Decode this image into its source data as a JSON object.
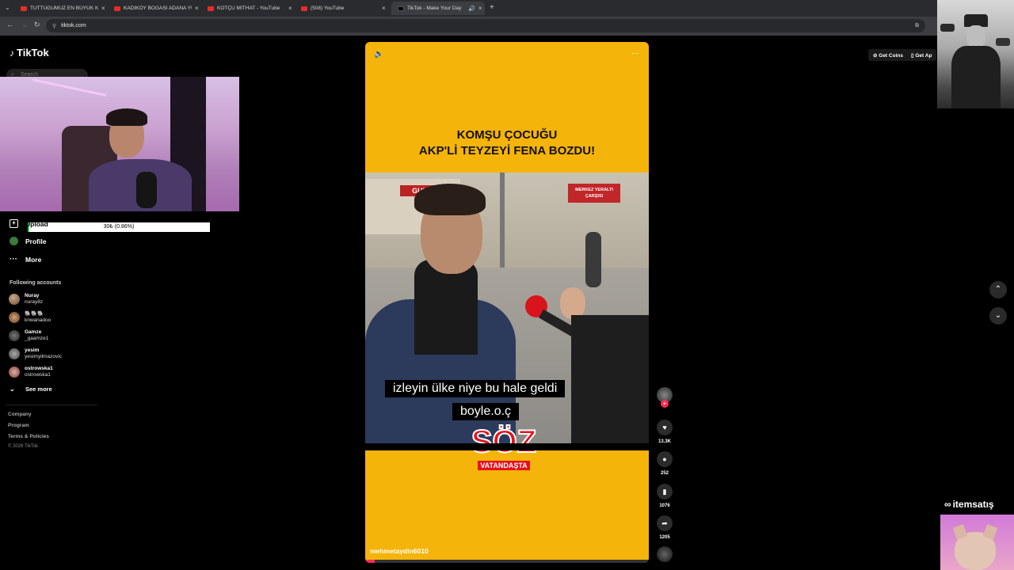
{
  "browser": {
    "tabs": [
      {
        "label": "TUTTUĞUMUZ EN BÜYÜK KILIÇ",
        "type": "youtube"
      },
      {
        "label": "KADIKÖY BOĞASI ADANA YÜRÜ",
        "type": "youtube"
      },
      {
        "label": "KOTÇU MİTHAT - YouTube",
        "type": "youtube"
      },
      {
        "label": "(508) YouTube",
        "type": "youtube"
      },
      {
        "label": "TikTok - Make Your Day",
        "type": "tiktok"
      }
    ],
    "new_tab": "+",
    "url": "tiktok.com"
  },
  "tiktok": {
    "logo": "TikTok",
    "search_placeholder": "Search",
    "nav": {
      "upload": "Upload",
      "profile": "Profile",
      "more": "More"
    },
    "following_title": "Following accounts",
    "accounts": [
      {
        "name": "Nuray",
        "user": "nuray8z"
      },
      {
        "name": "🐘🐘🐘",
        "user": "knwanadoo"
      },
      {
        "name": "Gamze",
        "user": "_gaamze1"
      },
      {
        "name": "yesim",
        "user": "yesimyilmazovic"
      },
      {
        "name": "ostrowska1",
        "user": "ostrowska1"
      }
    ],
    "see_more": "See more",
    "footer": [
      "Company",
      "Program",
      "Terms & Policies",
      "© 2026 TikTok"
    ],
    "top_right": {
      "get_coins": "Get Coins",
      "get_app": "Get Ap"
    }
  },
  "overlay": {
    "progress_text": "30₺ (0.86%)",
    "progress_value": 0.0086,
    "watermark": "itemsatış"
  },
  "video": {
    "headline_line1": "KOMŞU ÇOCUĞU",
    "headline_line2": "AKP'Lİ TEYZEYİ FENA BOZDU!",
    "subtitle_line1": "izleyin ülke niye bu hale geldi",
    "subtitle_line2": "boyle.o.ç",
    "logo_main": "SÖZ",
    "logo_sub": "VATANDAŞTA",
    "shop_sign_left": "GUL K",
    "shop_sign_right": "MERKEZ YERALTI ÇARŞISI",
    "author": "mehmetaydin6010"
  },
  "actions": {
    "likes": "13.3K",
    "comments": "252",
    "saves": "1076",
    "shares": "1205"
  }
}
